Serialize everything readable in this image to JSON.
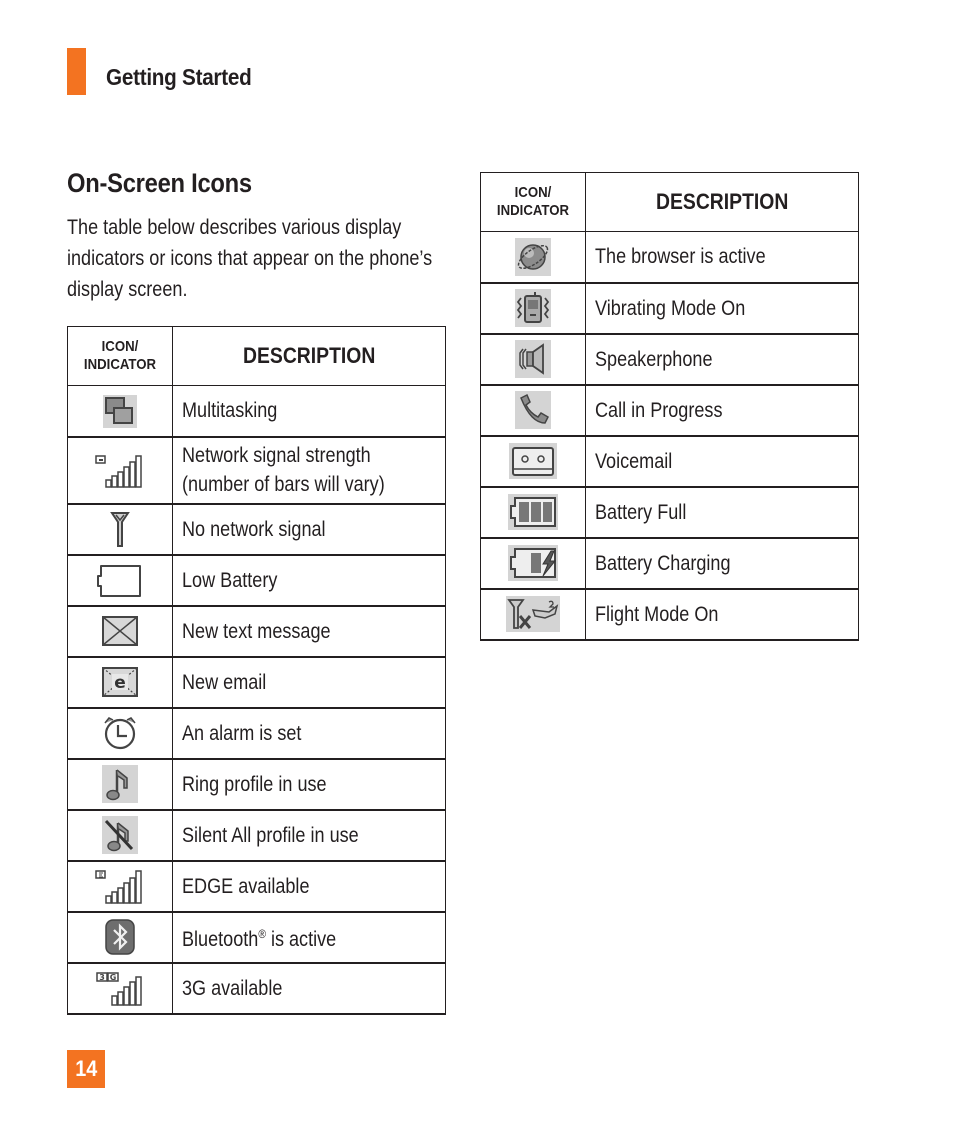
{
  "header": {
    "section_title": "Getting Started",
    "accent_color": "#f37321"
  },
  "page": {
    "heading": "On-Screen Icons",
    "intro_lines": [
      "The table below describes various display",
      "indicators or icons that appear on the phone’s",
      "display screen."
    ],
    "page_number": "14"
  },
  "table_headers": {
    "icon_line1": "ICON/",
    "icon_line2": "INDICATOR",
    "description": "DESCRIPTION"
  },
  "left_table": [
    {
      "icon": "multitasking-icon",
      "description": "Multitasking"
    },
    {
      "icon": "network-signal-icon",
      "description": "Network signal strength",
      "description_line2": "(number of bars will vary)"
    },
    {
      "icon": "no-network-signal-icon",
      "description": "No network signal"
    },
    {
      "icon": "low-battery-icon",
      "description": "Low Battery"
    },
    {
      "icon": "new-text-message-icon",
      "description": "New text message"
    },
    {
      "icon": "new-email-icon",
      "description": "New email"
    },
    {
      "icon": "alarm-icon",
      "description": "An alarm is set"
    },
    {
      "icon": "ring-profile-icon",
      "description": "Ring profile in use"
    },
    {
      "icon": "silent-all-profile-icon",
      "description": "Silent All profile in use"
    },
    {
      "icon": "edge-signal-icon",
      "description": "EDGE available"
    },
    {
      "icon": "bluetooth-icon",
      "description": "Bluetooth",
      "description_sup": "®",
      "description_suffix": " is active"
    },
    {
      "icon": "3g-signal-icon",
      "description": "3G available"
    }
  ],
  "right_table": [
    {
      "icon": "browser-icon",
      "description": "The browser is active"
    },
    {
      "icon": "vibrating-mode-icon",
      "description": "Vibrating Mode On"
    },
    {
      "icon": "speakerphone-icon",
      "description": "Speakerphone"
    },
    {
      "icon": "call-in-progress-icon",
      "description": "Call in Progress"
    },
    {
      "icon": "voicemail-icon",
      "description": "Voicemail"
    },
    {
      "icon": "battery-full-icon",
      "description": "Battery Full"
    },
    {
      "icon": "battery-charging-icon",
      "description": "Battery Charging"
    },
    {
      "icon": "flight-mode-icon",
      "description": "Flight Mode On"
    }
  ]
}
